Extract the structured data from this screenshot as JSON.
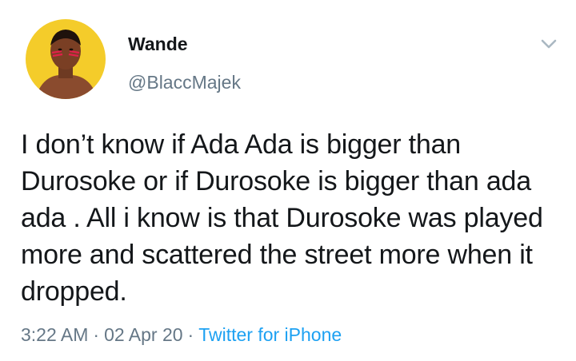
{
  "tweet": {
    "display_name": "Wande",
    "handle": "@BlaccMajek",
    "text": "I don’t know if Ada Ada is bigger than Durosoke or if Durosoke is bigger than ada ada . All i know is that Durosoke was played more and scattered the street more when it dropped.",
    "time": "3:22 AM",
    "date": "02 Apr 20",
    "source": "Twitter for iPhone",
    "separator": "·"
  },
  "icons": {
    "menu": "chevron-down-icon",
    "avatar": "profile-photo"
  },
  "colors": {
    "text_primary": "#14171a",
    "text_secondary": "#657786",
    "link": "#1da1f2",
    "avatar_background": "#f4cc2a"
  }
}
